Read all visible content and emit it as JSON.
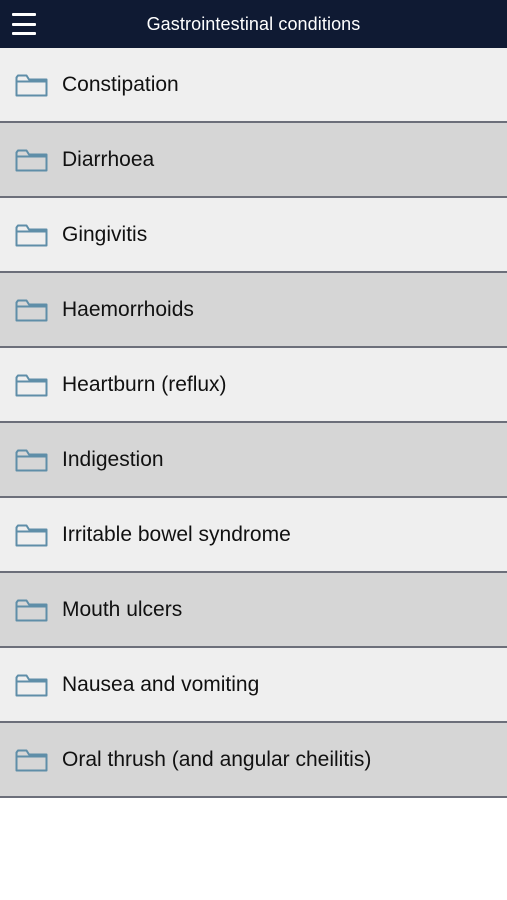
{
  "header": {
    "title": "Gastrointestinal conditions",
    "menu_icon": "hamburger-menu-icon"
  },
  "list": {
    "item_icon": "folder-icon",
    "items": [
      {
        "label": "Constipation"
      },
      {
        "label": "Diarrhoea"
      },
      {
        "label": "Gingivitis"
      },
      {
        "label": "Haemorrhoids"
      },
      {
        "label": "Heartburn (reflux)"
      },
      {
        "label": "Indigestion"
      },
      {
        "label": "Irritable bowel syndrome"
      },
      {
        "label": "Mouth ulcers"
      },
      {
        "label": "Nausea and vomiting"
      },
      {
        "label": "Oral thrush (and angular cheilitis)"
      }
    ]
  },
  "colors": {
    "header_bg": "#0f1a33",
    "row_odd_bg": "#efefef",
    "row_even_bg": "#d6d6d6",
    "folder_stroke": "#5f8ea8"
  }
}
